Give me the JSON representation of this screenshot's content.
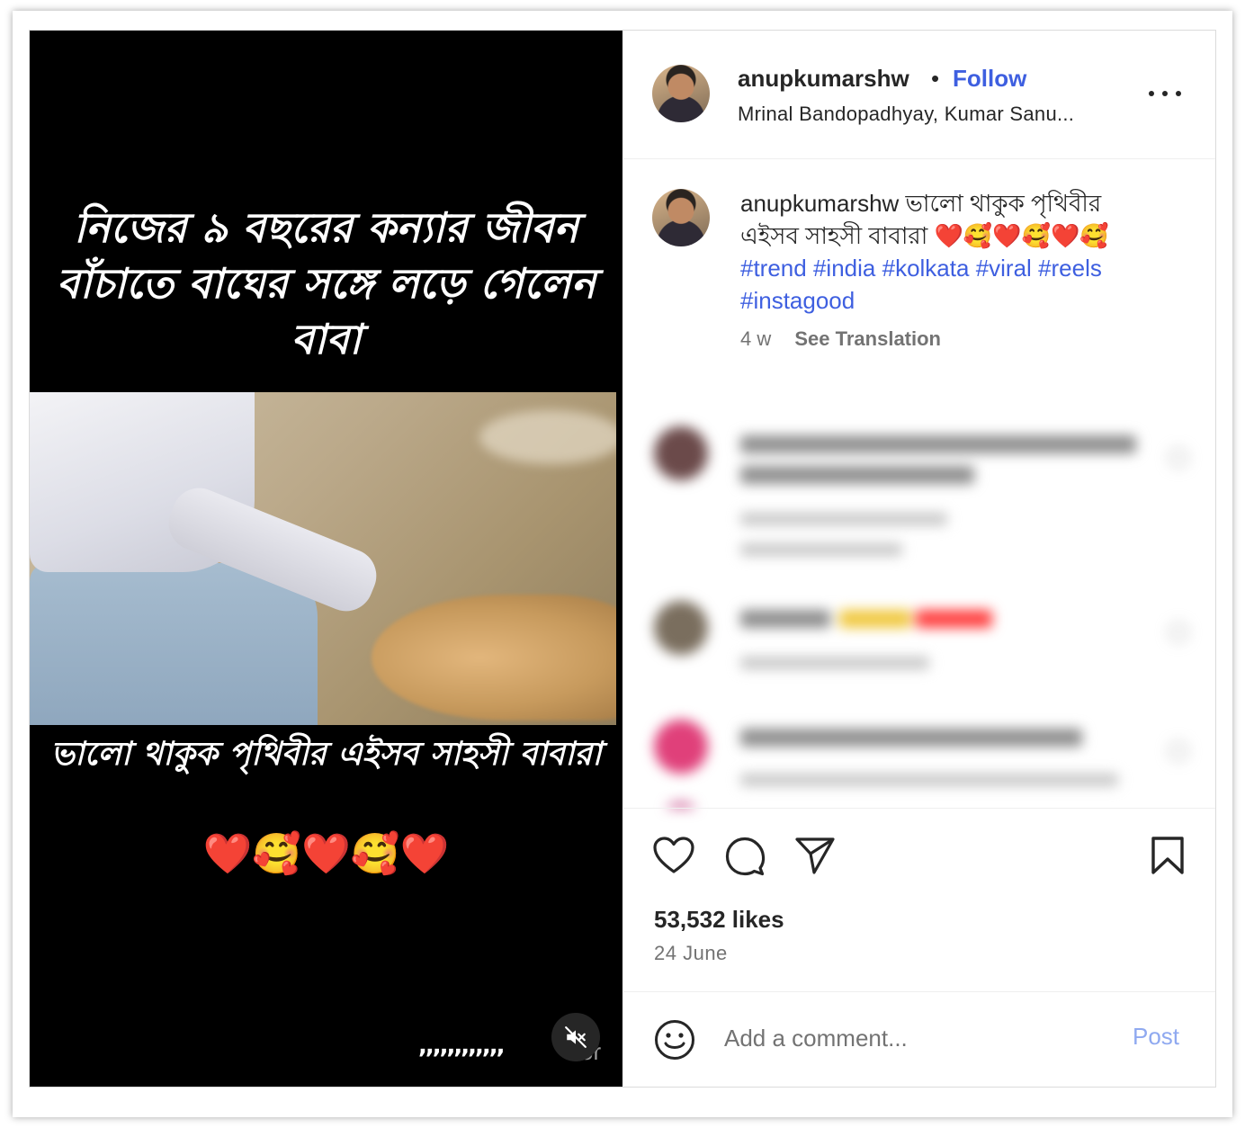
{
  "media": {
    "overlay_top": "নিজের ৯ বছরের কন্যার জীবন বাঁচাতে বাঘের সঙ্গে লড়ে গেলেন বাবা",
    "overlay_bottom": "ভালো থাকুক পৃথিবীর এইসব সাহসী বাবারা",
    "overlay_hearts": "❤️🥰❤️🥰❤️",
    "overlay_commas": ",,,,,,,,,,,,",
    "overlay_watermark": "or",
    "mute_icon": "speaker-muted-icon"
  },
  "header": {
    "username": "anupkumarshw",
    "separator": "•",
    "follow_label": "Follow",
    "audio": "Mrinal Bandopadhyay, Kumar Sanu...",
    "more_icon": "more-horizontal-icon"
  },
  "caption": {
    "username": "anupkumarshw",
    "text": "ভালো থাকুক পৃথিবীর এইসব সাহসী বাবারা ❤️🥰❤️🥰❤️🥰",
    "hashtags": [
      "#trend",
      "#india",
      "#kolkata",
      "#viral",
      "#reels",
      "#instagood"
    ],
    "age": "4 w",
    "see_translation": "See Translation"
  },
  "actions": {
    "like_icon": "heart-icon",
    "comment_icon": "comment-icon",
    "share_icon": "send-icon",
    "save_icon": "bookmark-icon",
    "likes": "53,532 likes",
    "date": "24 June"
  },
  "comment_box": {
    "emoji_icon": "emoji-icon",
    "placeholder": "Add a comment...",
    "post_label": "Post"
  },
  "colors": {
    "accent": "#3e5fe0",
    "post_disabled": "#8fa9f0",
    "text": "#262626",
    "muted": "#737373"
  }
}
